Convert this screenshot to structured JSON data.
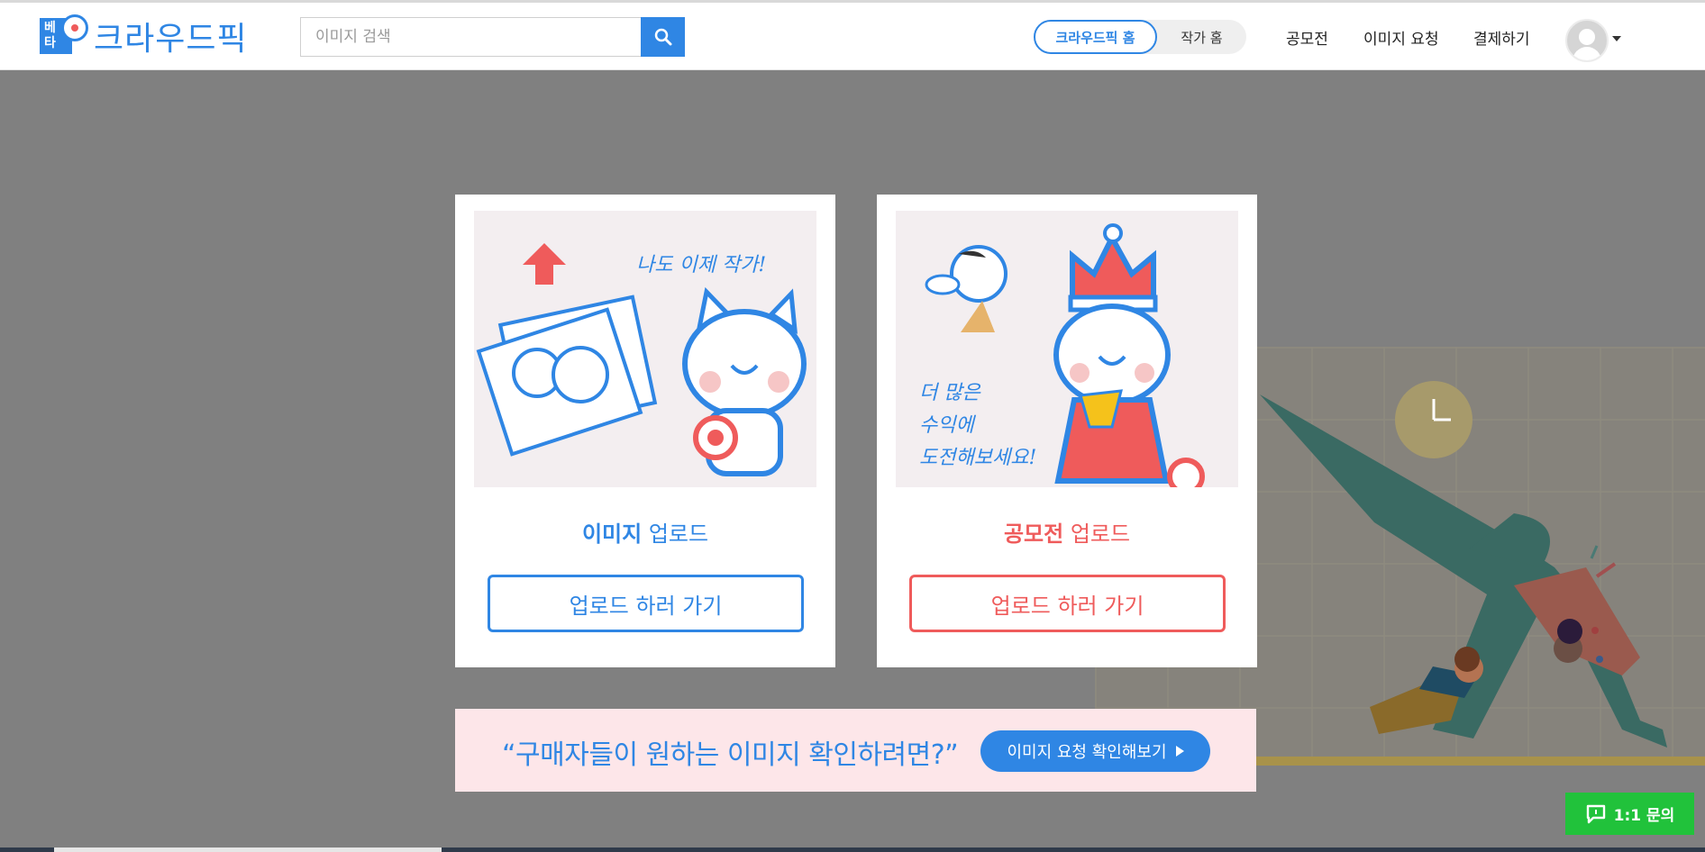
{
  "header": {
    "logo_badge": "베타",
    "logo_text": "크라우드픽",
    "search_placeholder": "이미지 검색",
    "search_icon": "search-icon",
    "toggle_active": "크라우드픽 홈",
    "toggle_inactive": "작가 홈",
    "nav": [
      "공모전",
      "이미지 요청",
      "결제하기"
    ],
    "avatar_icon": "user-avatar-icon"
  },
  "cards": [
    {
      "image_caption": "나도 이제 작가!",
      "title_strong": "이미지",
      "title_rest": " 업로드",
      "button": "업로드 하러 가기",
      "accent": "#2f86e4"
    },
    {
      "image_caption_lines": [
        "더 많은",
        "수익에",
        "도전해보세요!"
      ],
      "title_strong": "공모전",
      "title_rest": " 업로드",
      "button": "업로드 하러 가기",
      "accent": "#ef5b5b"
    }
  ],
  "banner": {
    "text": "“구매자들이 원하는 이미지 확인하려면?”",
    "button": "이미지 요청 확인해보기"
  },
  "chat": {
    "label": "1:1 문의",
    "icon": "chat-bubble-icon"
  },
  "colors": {
    "primary": "#2f86e4",
    "accent_red": "#ef5b5b",
    "chat_green": "#21c23b",
    "overlay": "#808080"
  }
}
